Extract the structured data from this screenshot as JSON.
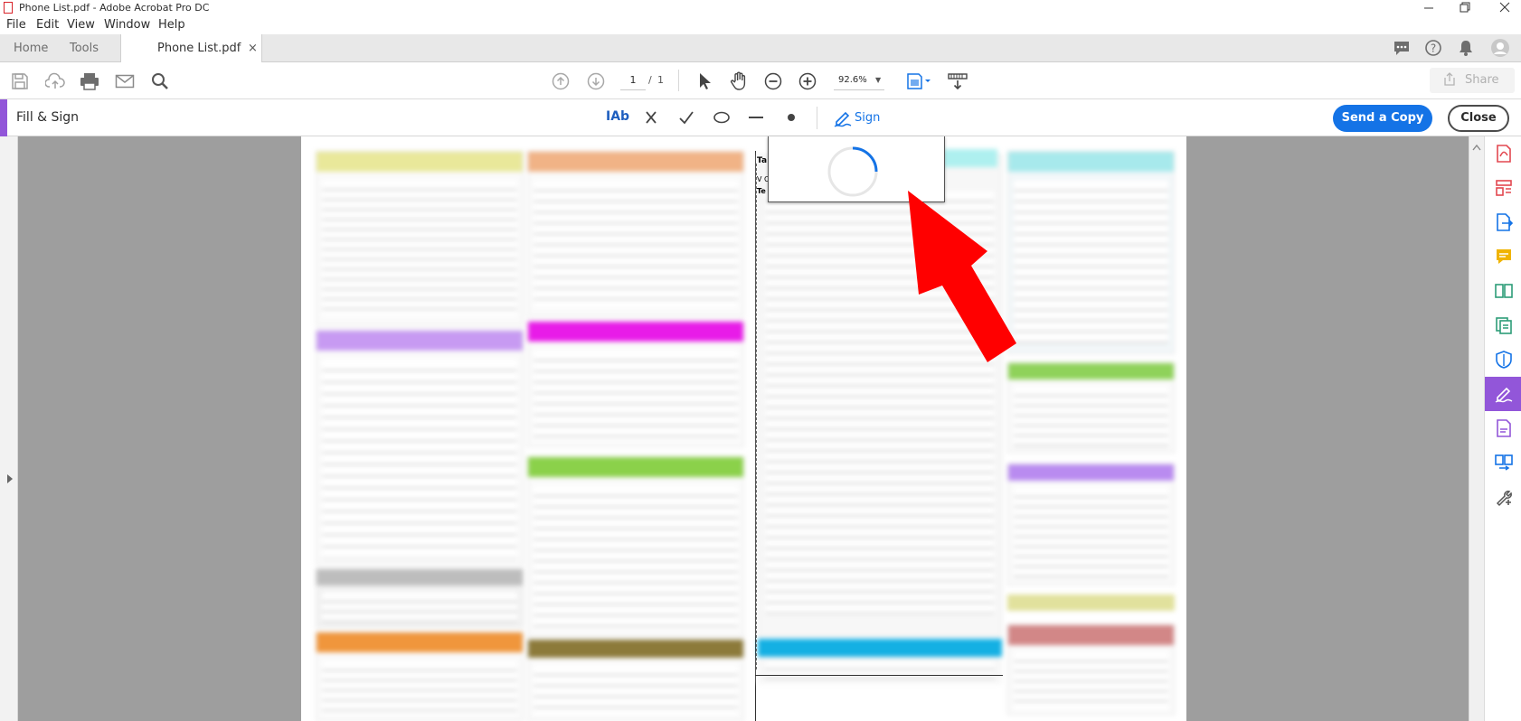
{
  "window": {
    "title": "Phone List.pdf - Adobe Acrobat Pro DC"
  },
  "menu": [
    "File",
    "Edit",
    "View",
    "Window",
    "Help"
  ],
  "tabs": {
    "home": "Home",
    "tools": "Tools",
    "document": "Phone List.pdf"
  },
  "toolbar": {
    "page_current": "1",
    "page_separator": "/",
    "page_total": "1",
    "zoom": "92.6%",
    "share_label": "Share"
  },
  "fill_sign": {
    "title": "Fill & Sign",
    "text_tool": "IAb",
    "sign_label": "Sign",
    "send_copy_label": "Send a Copy",
    "close_label": "Close"
  },
  "colors": {
    "accent": "#1473e6",
    "fill_sign_purple": "#9256d9",
    "pointer_arrow": "#ff0000"
  },
  "icons": [
    "save-icon",
    "upload-icon",
    "print-icon",
    "email-icon",
    "search-icon",
    "page-up-icon",
    "page-down-icon",
    "select-cursor-icon",
    "hand-icon",
    "zoom-out-icon",
    "zoom-in-icon",
    "fit-page-icon",
    "scroll-mode-icon",
    "comment-icon",
    "help-icon",
    "bell-icon",
    "account-icon",
    "cross-mark-icon",
    "checkmark-icon",
    "ellipse-icon",
    "line-icon",
    "dot-icon",
    "sign-pen-icon",
    "loading-spinner-icon",
    "red-arrow-pointer"
  ]
}
